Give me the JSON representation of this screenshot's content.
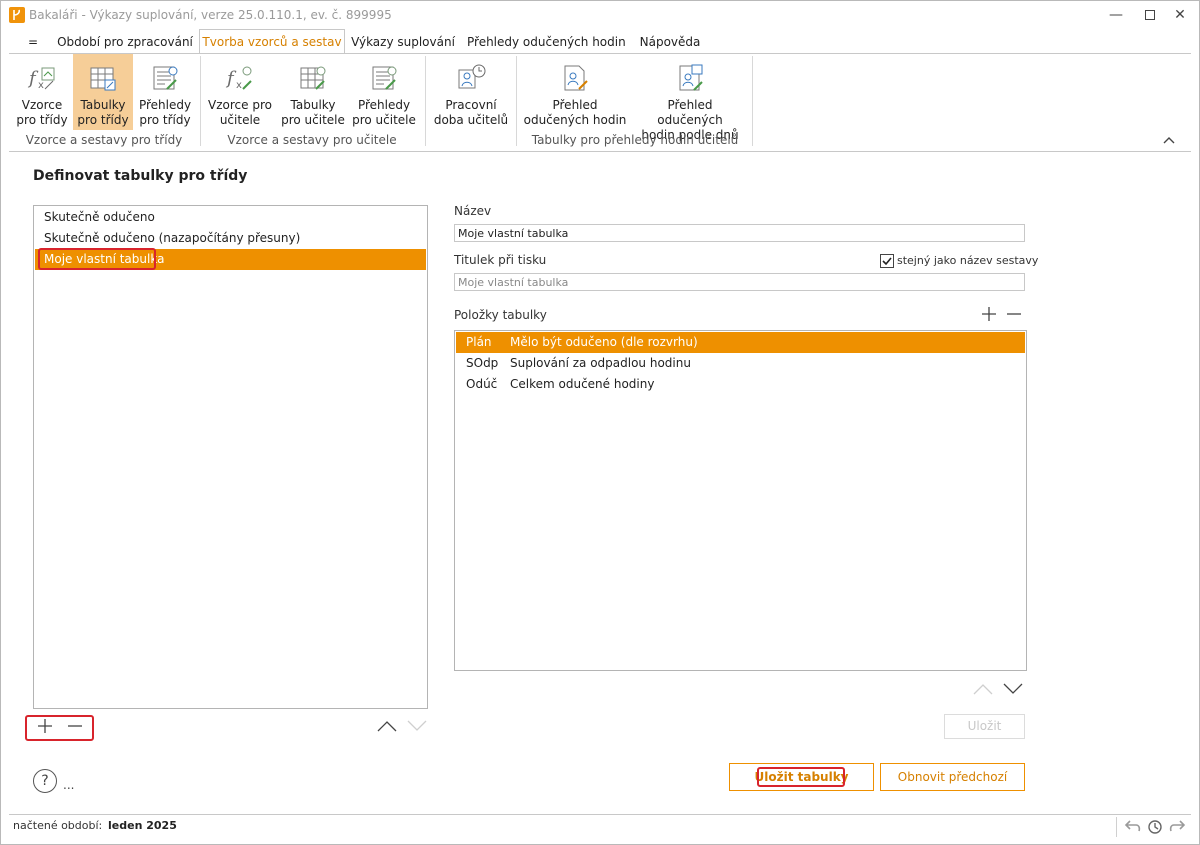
{
  "window": {
    "title": "Bakaláři - Výkazy suplování, verze 25.0.110.1, ev. č. 899995"
  },
  "tabs": [
    {
      "label": "="
    },
    {
      "label": "Období pro zpracování"
    },
    {
      "label": "Tvorba vzorců a sestav",
      "active": true
    },
    {
      "label": "Výkazy suplování"
    },
    {
      "label": "Přehledy odučených hodin"
    },
    {
      "label": "Nápověda"
    }
  ],
  "ribbon": {
    "groups": [
      {
        "label": "Vzorce a sestavy pro třídy"
      },
      {
        "label": "Vzorce a sestavy pro učitele"
      },
      {
        "label": ""
      },
      {
        "label": "Tabulky pro přehledy hodin učitelů"
      }
    ],
    "buttons": [
      {
        "line1": "Vzorce",
        "line2": "pro třídy",
        "icon": "formula-icon"
      },
      {
        "line1": "Tabulky",
        "line2": "pro třídy",
        "icon": "table-icon",
        "selected": true
      },
      {
        "line1": "Přehledy",
        "line2": "pro třídy",
        "icon": "report-icon"
      },
      {
        "line1": "Vzorce pro",
        "line2": "učitele",
        "icon": "formula-icon"
      },
      {
        "line1": "Tabulky",
        "line2": "pro učitele",
        "icon": "table-icon"
      },
      {
        "line1": "Přehledy",
        "line2": "pro učitele",
        "icon": "report-icon"
      },
      {
        "line1": "Pracovní",
        "line2": "doba učitelů",
        "icon": "clock-person-icon"
      },
      {
        "line1": "Přehled",
        "line2": "odučených hodin",
        "icon": "document-edit-icon"
      },
      {
        "line1": "Přehled odučených",
        "line2": "hodin podle dnů",
        "icon": "document-calendar-icon"
      }
    ]
  },
  "page": {
    "heading": "Definovat tabulky pro třídy"
  },
  "table_list": {
    "items": [
      {
        "label": "Skutečně odučeno"
      },
      {
        "label": "Skutečně odučeno (nazapočítány přesuny)"
      },
      {
        "label": "Moje vlastní tabulka",
        "selected": true
      }
    ]
  },
  "detail": {
    "name_label": "Název",
    "name_value": "Moje vlastní tabulka",
    "print_title_label": "Titulek při tisku",
    "same_as_name_label": "stejný jako název sestavy",
    "same_as_name_checked": true,
    "print_title_value": "Moje vlastní tabulka",
    "items_label": "Položky tabulky",
    "items": [
      {
        "code": "Plán",
        "desc": "Mělo být odučeno (dle rozvrhu)",
        "selected": true
      },
      {
        "code": "SOdp",
        "desc": "Suplování za odpadlou hodinu"
      },
      {
        "code": "Odúč",
        "desc": "Celkem odučené hodiny"
      }
    ]
  },
  "buttons": {
    "save_small": "Uložit",
    "save_tables": "Uložit tabulky",
    "restore": "Obnovit předchozí",
    "help": "?",
    "more": "..."
  },
  "status": {
    "period_label": "načtené období:",
    "period_value": "leden 2025"
  },
  "colors": {
    "accent": "#ee9000",
    "accent_text": "#d68000",
    "selected_ribbon": "#f6ce98",
    "highlight_box": "#d8242c"
  }
}
